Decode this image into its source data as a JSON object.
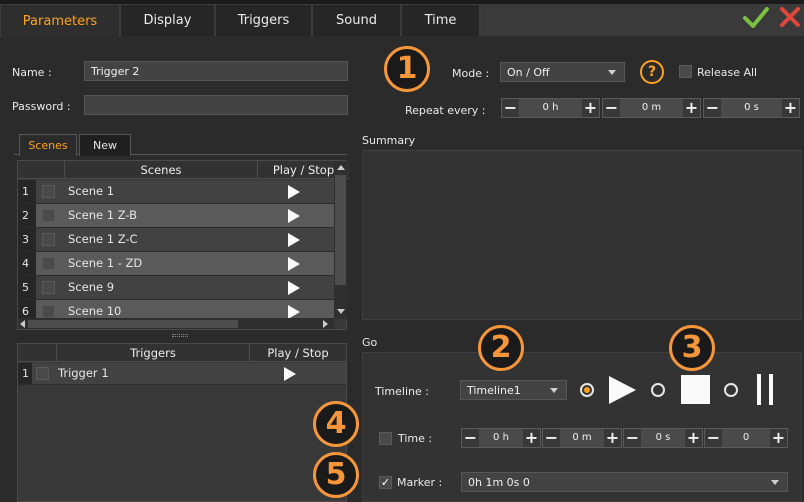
{
  "tabs": [
    {
      "label": "Parameters",
      "active": true
    },
    {
      "label": "Display"
    },
    {
      "label": "Triggers"
    },
    {
      "label": "Sound"
    },
    {
      "label": "Time"
    }
  ],
  "name": {
    "label": "Name :",
    "value": "Trigger 2"
  },
  "password": {
    "label": "Password :",
    "value": ""
  },
  "mode": {
    "label": "Mode :",
    "value": "On / Off",
    "help": "?",
    "release_label": "Release All"
  },
  "repeat": {
    "label": "Repeat every :",
    "hours": "0 h",
    "minutes": "0 m",
    "seconds": "0 s"
  },
  "scenes_tabs": [
    {
      "label": "Scenes",
      "active": true
    },
    {
      "label": "New"
    }
  ],
  "scenes_table": {
    "headers": [
      "Scenes",
      "Play / Stop"
    ],
    "rows": [
      {
        "num": "1",
        "name": "Scene 1"
      },
      {
        "num": "2",
        "name": "Scene 1 Z-B"
      },
      {
        "num": "3",
        "name": "Scene 1 Z-C"
      },
      {
        "num": "4",
        "name": "Scene 1 - ZD"
      },
      {
        "num": "5",
        "name": "Scene 9"
      },
      {
        "num": "6",
        "name": "Scene 10"
      }
    ]
  },
  "triggers_table": {
    "headers": [
      "Triggers",
      "Play / Stop"
    ],
    "rows": [
      {
        "num": "1",
        "name": "Trigger 1"
      }
    ]
  },
  "summary": {
    "label": "Summary"
  },
  "go": {
    "label": "Go",
    "timeline_label": "Timeline :",
    "timeline_value": "Timeline1",
    "time_label": "Time :",
    "time": {
      "hours": "0 h",
      "minutes": "0 m",
      "seconds": "0 s",
      "frames": "0"
    },
    "marker_label": "Marker :",
    "marker_checked": true,
    "marker_value": "0h 1m 0s 0"
  },
  "badges": [
    "1",
    "2",
    "3",
    "4",
    "5"
  ],
  "colors": {
    "accent": "#ffa21f",
    "badge": "#f6963b",
    "ok": "#7cc242",
    "close": "#e0473a"
  }
}
